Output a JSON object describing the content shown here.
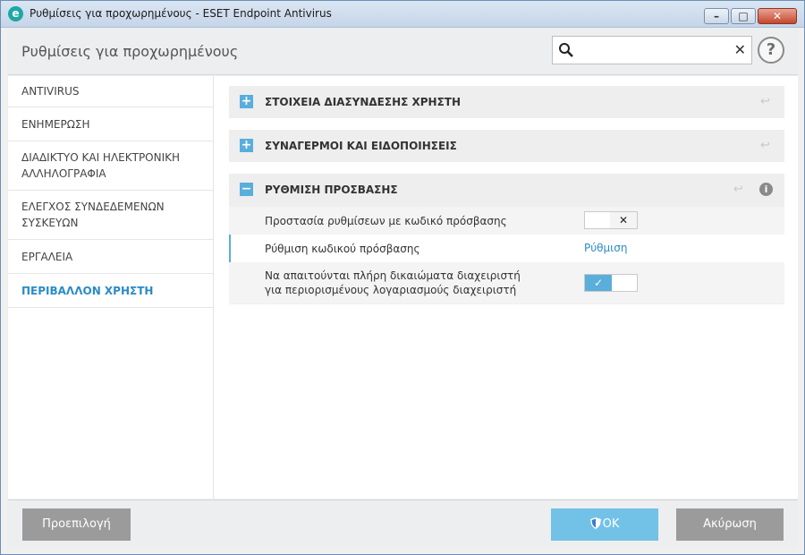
{
  "window": {
    "title": "Ρυθμίσεις για προχωρημένους - ESET Endpoint Antivirus",
    "app_icon_letter": "e"
  },
  "header": {
    "title": "Ρυθμίσεις για προχωρημένους",
    "search": {
      "value": "",
      "placeholder": ""
    },
    "help_label": "?"
  },
  "sidebar": {
    "items": [
      {
        "label": "ANTIVIRUS",
        "active": false
      },
      {
        "label": "ΕΝΗΜΕΡΩΣΗ",
        "active": false
      },
      {
        "label": "ΔΙΑΔΙΚΤΥΟ ΚΑΙ ΗΛΕΚΤΡΟΝΙΚΗ ΑΛΛΗΛΟΓΡΑΦΙΑ",
        "active": false
      },
      {
        "label": "ΕΛΕΓΧΟΣ ΣΥΝΔΕΔΕΜΕΝΩΝ ΣΥΣΚΕΥΩΝ",
        "active": false
      },
      {
        "label": "ΕΡΓΑΛΕΙΑ",
        "active": false
      },
      {
        "label": "ΠΕΡΙΒΑΛΛΟΝ ΧΡΗΣΤΗ",
        "active": true
      }
    ]
  },
  "sections": [
    {
      "title": "ΣΤΟΙΧΕΙΑ ΔΙΑΣΥΝΔΕΣΗΣ ΧΡΗΣΤΗ",
      "toggle": "+",
      "expanded": false
    },
    {
      "title": "ΣΥΝΑΓΕΡΜΟΙ ΚΑΙ ΕΙΔΟΠΟΙΗΣΕΙΣ",
      "toggle": "+",
      "expanded": false
    },
    {
      "title": "ΡΥΘΜΙΣΗ ΠΡΟΣΒΑΣΗΣ",
      "toggle": "−",
      "expanded": true,
      "rows": [
        {
          "label": "Προστασία ρυθμίσεων με κωδικό πρόσβασης",
          "control": "toggle",
          "state": "off",
          "glyph": "✕"
        },
        {
          "label": "Ρύθμιση κωδικού πρόσβασης",
          "control": "link",
          "link_text": "Ρύθμιση"
        },
        {
          "label": "Να απαιτούνται πλήρη δικαιώματα διαχειριστή για περιορισμένους λογαριασμούς διαχειριστή",
          "control": "toggle",
          "state": "on",
          "glyph": "✓"
        }
      ]
    }
  ],
  "footer": {
    "default_label": "Προεπιλογή",
    "ok_label": "OK",
    "cancel_label": "Ακύρωση"
  },
  "colors": {
    "accent": "#2a8bc7",
    "toggle_on": "#5aaedb",
    "ok_button": "#72c1e7",
    "neutral_button": "#9b9b9b"
  }
}
